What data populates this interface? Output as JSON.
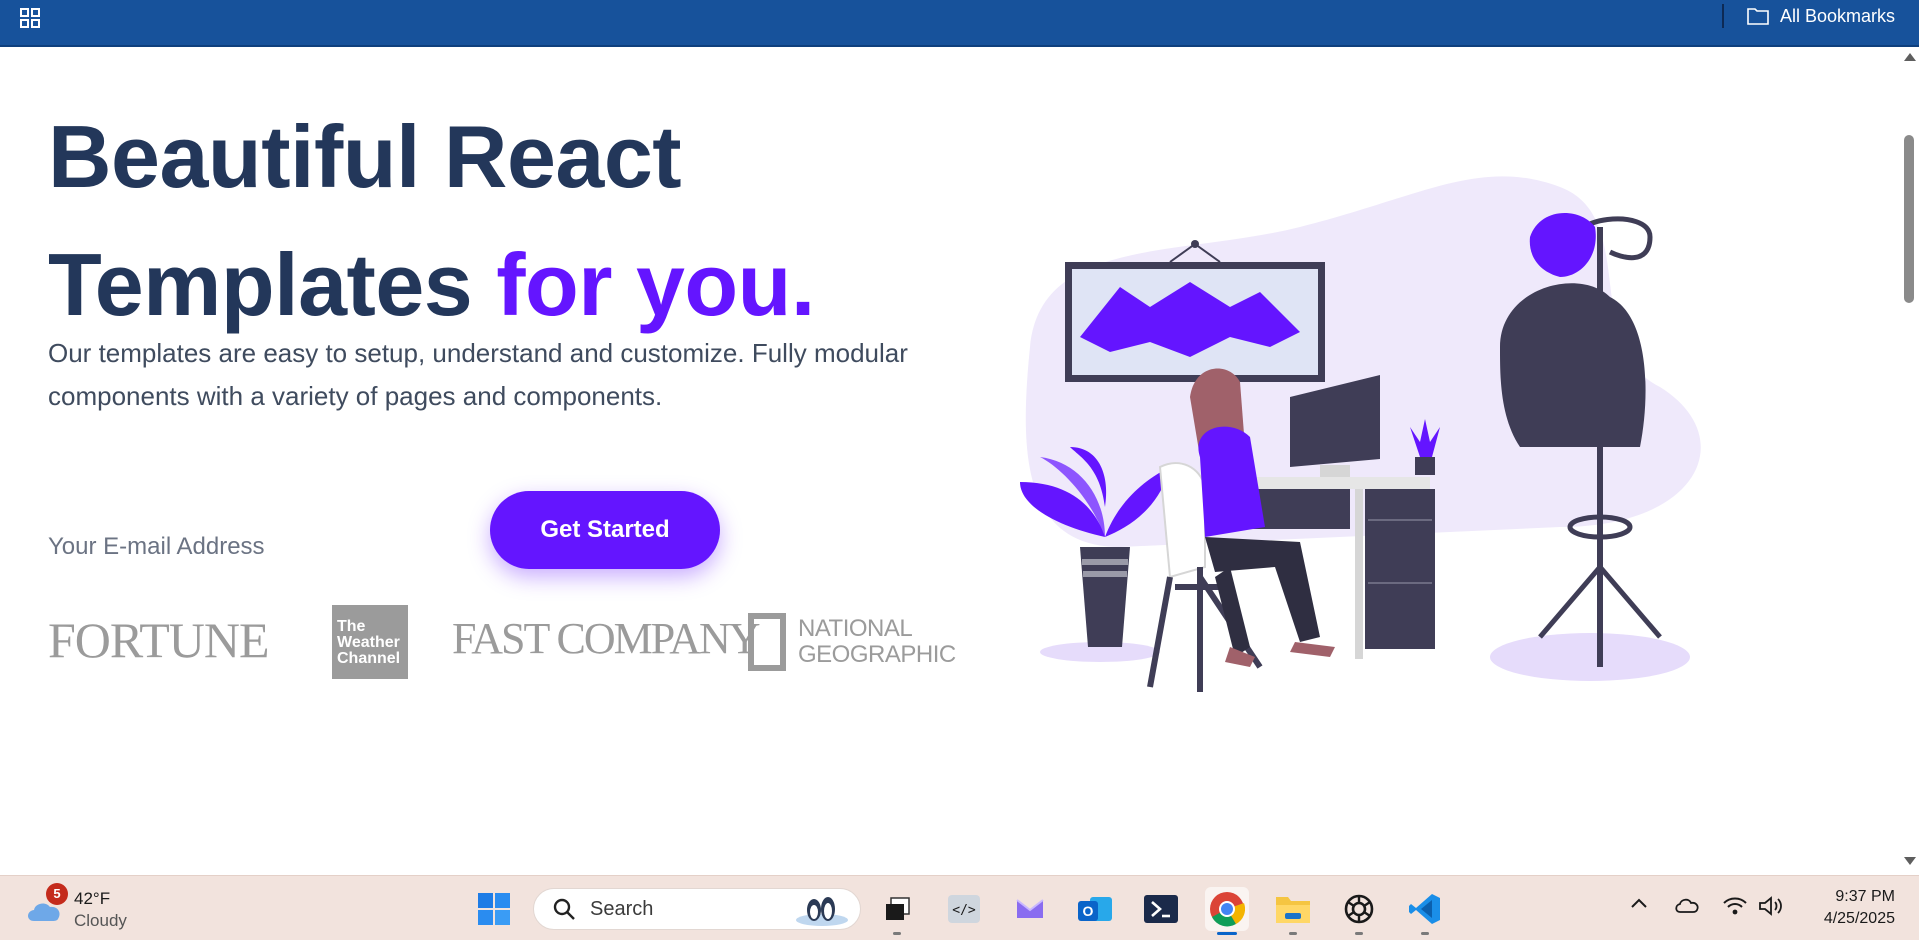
{
  "browser": {
    "bookmarks_label": "All Bookmarks"
  },
  "hero": {
    "title_line1": "Beautiful React",
    "title_line2_prefix": "Templates",
    "title_line2_accent": "for you.",
    "description": "Our templates are easy to setup, understand and customize. Fully modular components with a variety of pages and components.",
    "email_placeholder": "Your E-mail Address",
    "cta_label": "Get Started"
  },
  "logos": {
    "fortune": "FORTUNE",
    "weather_channel": "The Weather Channel",
    "fast_company": "FAST COMPANY",
    "national_geographic": "NATIONAL GEOGRAPHIC"
  },
  "colors": {
    "heading": "#23375a",
    "accent": "#6415ff",
    "topbar": "#17529b",
    "taskbar": "#f2e3dd"
  },
  "taskbar": {
    "weather": {
      "temp": "42°F",
      "condition": "Cloudy",
      "badge": "5"
    },
    "search_label": "Search",
    "apps": [
      {
        "name": "start-icon"
      },
      {
        "name": "task-view-icon"
      },
      {
        "name": "dev-tools-icon"
      },
      {
        "name": "mail-icon"
      },
      {
        "name": "outlook-icon"
      },
      {
        "name": "terminal-icon"
      },
      {
        "name": "chrome-icon"
      },
      {
        "name": "file-explorer-icon"
      },
      {
        "name": "chatgpt-icon"
      },
      {
        "name": "vscode-icon"
      }
    ],
    "clock": {
      "time": "9:37 PM",
      "date": "4/25/2025"
    }
  }
}
